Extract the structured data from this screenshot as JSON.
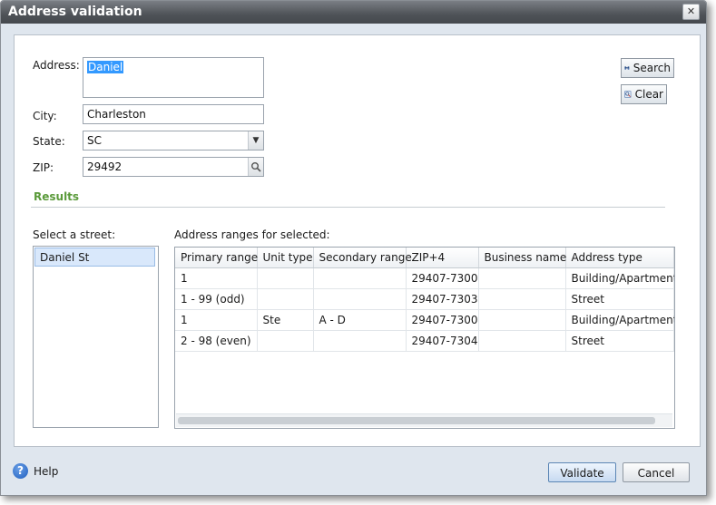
{
  "dialog": {
    "title": "Address validation",
    "close_label": "✕"
  },
  "form": {
    "address_label": "Address:",
    "address_value": "Daniel",
    "city_label": "City:",
    "city_value": "Charleston",
    "state_label": "State:",
    "state_value": "SC",
    "zip_label": "ZIP:",
    "zip_value": "29492"
  },
  "actions": {
    "search_label": "Search",
    "clear_label": "Clear"
  },
  "results": {
    "title": "Results",
    "street_label": "Select a street:",
    "streets": [
      "Daniel St"
    ],
    "ranges_label": "Address ranges for selected:",
    "columns": [
      "Primary range",
      "Unit type",
      "Secondary range",
      "ZIP+4",
      "Business name",
      "Address type"
    ],
    "rows": [
      [
        "1",
        "",
        "",
        "29407-7300",
        "",
        "Building/Apartment"
      ],
      [
        "1 - 99 (odd)",
        "",
        "",
        "29407-7303",
        "",
        "Street"
      ],
      [
        "1",
        "Ste",
        "A - D",
        "29407-7300",
        "",
        "Building/Apartment"
      ],
      [
        "2 - 98 (even)",
        "",
        "",
        "29407-7304",
        "",
        "Street"
      ]
    ]
  },
  "footer": {
    "help_label": "Help",
    "validate_label": "Validate",
    "cancel_label": "Cancel"
  },
  "icons": {
    "search": "binoculars-icon",
    "clear": "clear-search-icon",
    "help": "help-icon",
    "zip_lookup": "magnifier-icon",
    "state_dropdown": "chevron-down-icon"
  },
  "colors": {
    "titlebar": "#4f5358",
    "results_title": "#5a9a3a",
    "selection": "#3399ff",
    "row_selected": "#d9e8fb"
  }
}
